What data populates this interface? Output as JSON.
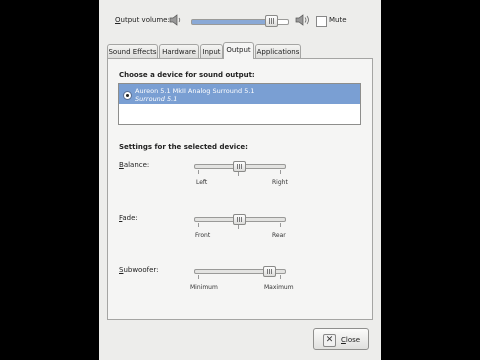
{
  "volume": {
    "label_accel": "O",
    "label_rest": "utput volume:",
    "level": 0.82,
    "mute_label": "Mute",
    "icons": [
      "speaker-low-icon",
      "speaker-high-icon"
    ]
  },
  "tabs": [
    {
      "label": "Sound Effects"
    },
    {
      "label": "Hardware"
    },
    {
      "label": "Input"
    },
    {
      "label": "Output",
      "active": true
    },
    {
      "label": "Applications"
    }
  ],
  "output": {
    "choose_heading": "Choose a device for sound output:",
    "device_name": "Aureon 5.1 MkII Analog Surround 5.1",
    "device_profile": "Surround 5.1",
    "settings_heading": "Settings for the selected device:",
    "balance": {
      "accel": "B",
      "rest": "alance:",
      "min": "Left",
      "max": "Right",
      "value": 0.5
    },
    "fade": {
      "accel": "F",
      "rest": "ade:",
      "min": "Front",
      "max": "Rear",
      "value": 0.5
    },
    "subwoofer": {
      "accel": "S",
      "rest": "ubwoofer:",
      "min": "Minimum",
      "max": "Maximum",
      "value": 0.82
    }
  },
  "close_button": {
    "accel": "C",
    "rest": "lose"
  }
}
